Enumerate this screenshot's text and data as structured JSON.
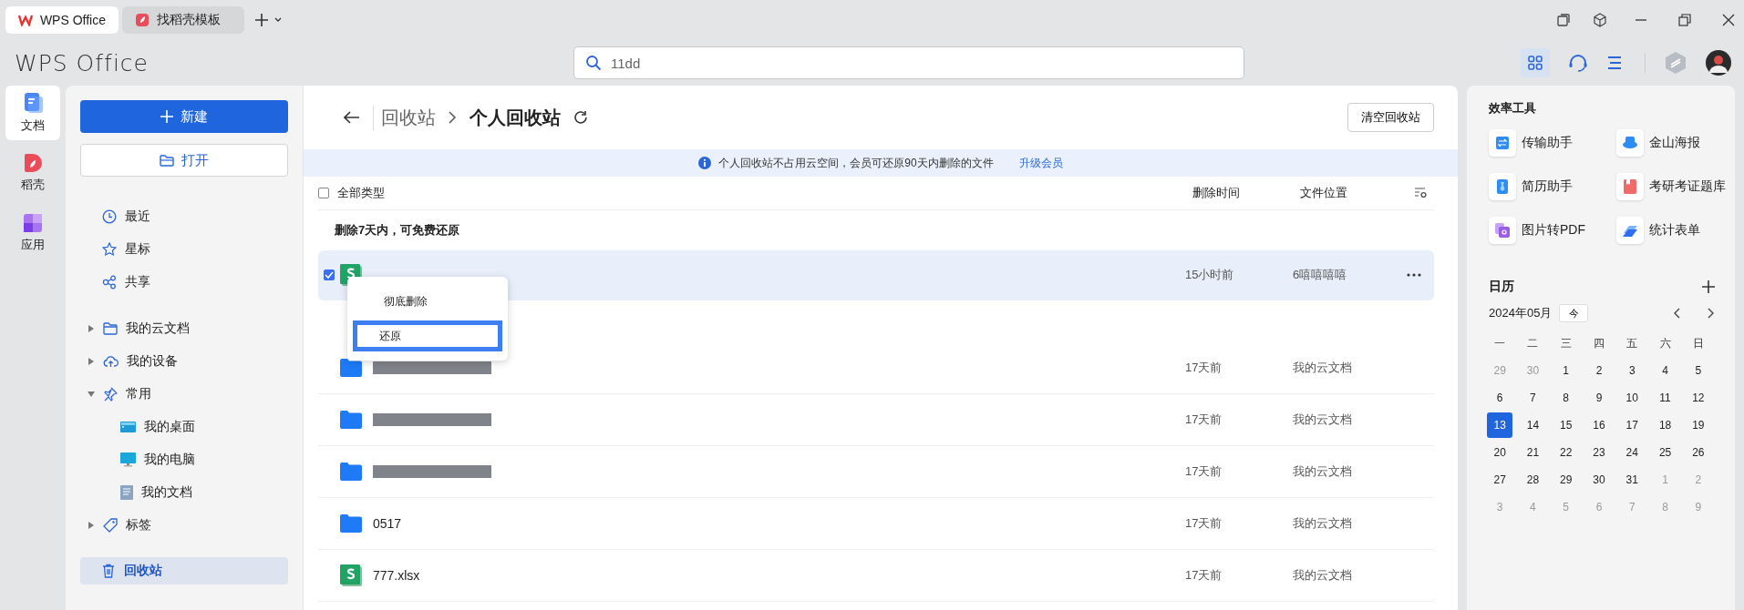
{
  "browser_tabs": [
    {
      "label": "WPS Office",
      "selected": true,
      "kind": "wps"
    },
    {
      "label": "找稻壳模板",
      "selected": false,
      "kind": "docer"
    }
  ],
  "logo": "WPS Office",
  "search": {
    "value": "11dd"
  },
  "rail": [
    {
      "label": "文档",
      "selected": true,
      "kind": "doc"
    },
    {
      "label": "稻壳",
      "selected": false,
      "kind": "docer"
    },
    {
      "label": "应用",
      "selected": false,
      "kind": "apps"
    }
  ],
  "new_button": "新建",
  "open_button": "打开",
  "quick": [
    {
      "label": "最近",
      "kind": "clock"
    },
    {
      "label": "星标",
      "kind": "star"
    },
    {
      "label": "共享",
      "kind": "share"
    }
  ],
  "tree": [
    {
      "label": "我的云文档",
      "kind": "folder",
      "expanded": false
    },
    {
      "label": "我的设备",
      "kind": "cloud",
      "expanded": false
    },
    {
      "label": "常用",
      "kind": "pin",
      "expanded": true,
      "children": [
        {
          "label": "我的桌面",
          "kind": "desktop"
        },
        {
          "label": "我的电脑",
          "kind": "computer"
        },
        {
          "label": "我的文档",
          "kind": "document"
        }
      ]
    },
    {
      "label": "标签",
      "kind": "tag",
      "expanded": false
    }
  ],
  "recycle": {
    "label": "回收站",
    "selected": true
  },
  "breadcrumb": {
    "parent": "回收站",
    "current": "个人回收站"
  },
  "empty_button": "清空回收站",
  "notice": {
    "text": "个人回收站不占用云空间，会员可还原90天内删除的文件",
    "link": "升级会员"
  },
  "columns": {
    "select_all": {
      "label": "全部类型",
      "checked": false
    },
    "deleted": "删除时间",
    "location": "文件位置"
  },
  "groups": [
    {
      "heading": "删除7天内，可免费还原",
      "rows": [
        {
          "kind": "sheet",
          "selected": true,
          "checked": true,
          "deleted": "15小时前",
          "location": "6嘻嘻嘻嘻"
        }
      ]
    },
    {
      "rows": [
        {
          "kind": "folder",
          "redacted": true,
          "selected": false,
          "deleted": "17天前",
          "location": "我的云文档"
        },
        {
          "kind": "folder",
          "redacted": true,
          "selected": false,
          "deleted": "17天前",
          "location": "我的云文档"
        },
        {
          "kind": "folder",
          "redacted": true,
          "selected": false,
          "deleted": "17天前",
          "location": "我的云文档"
        },
        {
          "kind": "folder",
          "name": "0517",
          "selected": false,
          "deleted": "17天前",
          "location": "我的云文档"
        },
        {
          "kind": "sheet",
          "name": "777.xlsx",
          "selected": false,
          "deleted": "17天前",
          "location": "我的云文档"
        }
      ]
    }
  ],
  "context_menu": [
    {
      "label": "彻底删除",
      "focused": false
    },
    {
      "label": "还原",
      "focused": true
    }
  ],
  "tools_title": "效率工具",
  "tools": [
    {
      "label": "传输助手",
      "kind": "transfer"
    },
    {
      "label": "金山海报",
      "kind": "poster"
    },
    {
      "label": "简历助手",
      "kind": "resume"
    },
    {
      "label": "考研考证题库",
      "kind": "exam"
    },
    {
      "label": "图片转PDF",
      "kind": "imgpdf"
    },
    {
      "label": "统计表单",
      "kind": "form"
    }
  ],
  "calendar": {
    "title": "日历",
    "month": "2024年05月",
    "today": "今",
    "weekdays": [
      "一",
      "二",
      "三",
      "四",
      "五",
      "六",
      "日"
    ],
    "days": [
      {
        "day": "29",
        "muted": true,
        "selected": false
      },
      {
        "day": "30",
        "muted": true,
        "selected": false
      },
      {
        "day": "1",
        "muted": false,
        "selected": false
      },
      {
        "day": "2",
        "muted": false,
        "selected": false
      },
      {
        "day": "3",
        "muted": false,
        "selected": false
      },
      {
        "day": "4",
        "muted": false,
        "selected": false
      },
      {
        "day": "5",
        "muted": false,
        "selected": false
      },
      {
        "day": "6",
        "muted": false,
        "selected": false
      },
      {
        "day": "7",
        "muted": false,
        "selected": false
      },
      {
        "day": "8",
        "muted": false,
        "selected": false
      },
      {
        "day": "9",
        "muted": false,
        "selected": false
      },
      {
        "day": "10",
        "muted": false,
        "selected": false
      },
      {
        "day": "11",
        "muted": false,
        "selected": false
      },
      {
        "day": "12",
        "muted": false,
        "selected": false
      },
      {
        "day": "13",
        "muted": false,
        "selected": true
      },
      {
        "day": "14",
        "muted": false,
        "selected": false
      },
      {
        "day": "15",
        "muted": false,
        "selected": false
      },
      {
        "day": "16",
        "muted": false,
        "selected": false
      },
      {
        "day": "17",
        "muted": false,
        "selected": false
      },
      {
        "day": "18",
        "muted": false,
        "selected": false
      },
      {
        "day": "19",
        "muted": false,
        "selected": false
      },
      {
        "day": "20",
        "muted": false,
        "selected": false
      },
      {
        "day": "21",
        "muted": false,
        "selected": false
      },
      {
        "day": "22",
        "muted": false,
        "selected": false
      },
      {
        "day": "23",
        "muted": false,
        "selected": false
      },
      {
        "day": "24",
        "muted": false,
        "selected": false
      },
      {
        "day": "25",
        "muted": false,
        "selected": false
      },
      {
        "day": "26",
        "muted": false,
        "selected": false
      },
      {
        "day": "27",
        "muted": false,
        "selected": false
      },
      {
        "day": "28",
        "muted": false,
        "selected": false
      },
      {
        "day": "29",
        "muted": false,
        "selected": false
      },
      {
        "day": "30",
        "muted": false,
        "selected": false
      },
      {
        "day": "31",
        "muted": false,
        "selected": false
      },
      {
        "day": "1",
        "muted": true,
        "selected": false
      },
      {
        "day": "2",
        "muted": true,
        "selected": false
      },
      {
        "day": "3",
        "muted": true,
        "selected": false
      },
      {
        "day": "4",
        "muted": true,
        "selected": false
      },
      {
        "day": "5",
        "muted": true,
        "selected": false
      },
      {
        "day": "6",
        "muted": true,
        "selected": false
      },
      {
        "day": "7",
        "muted": true,
        "selected": false
      },
      {
        "day": "8",
        "muted": true,
        "selected": false
      },
      {
        "day": "9",
        "muted": true,
        "selected": false
      }
    ]
  }
}
